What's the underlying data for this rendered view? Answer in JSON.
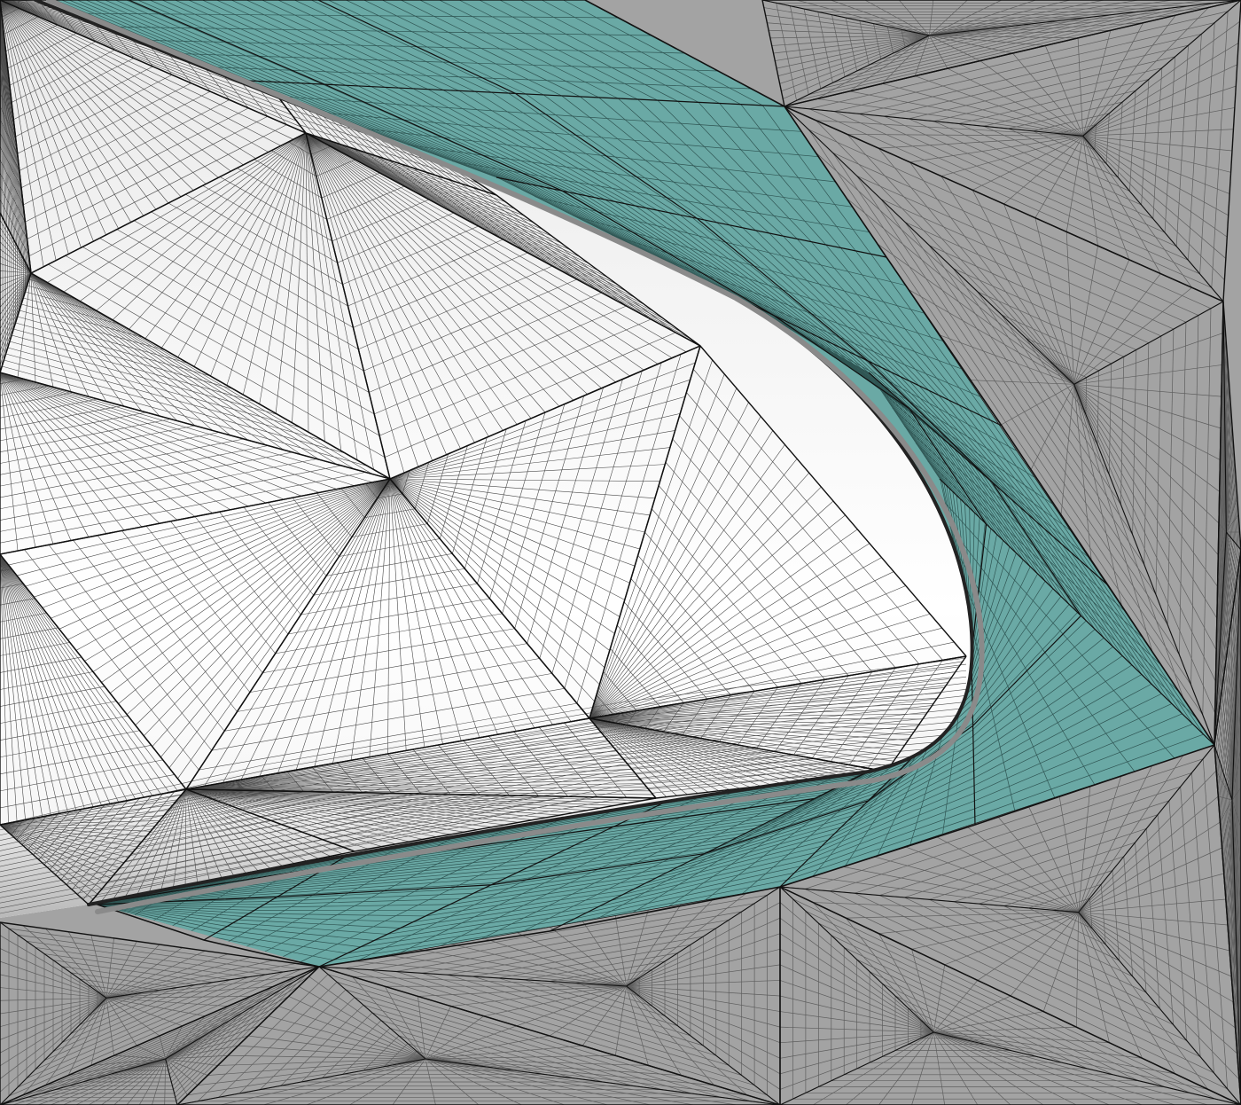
{
  "scene": {
    "colors": {
      "background": "#9f9f9f",
      "far_field_mesh": "#a3a3a3",
      "boundary_layer": "#6aa9a5",
      "body_surface": "#f2f2f2",
      "body_shadow": "#8a8a8a",
      "grid_line": "#3a3a3a",
      "block_edge": "#111111"
    }
  }
}
